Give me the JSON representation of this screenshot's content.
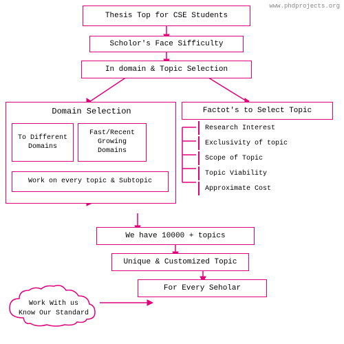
{
  "watermark": "www.phdprojects.org",
  "boxes": {
    "thesis": "Thesis Top for CSE Students",
    "scholar_difficulty": "Scholor's Face Sifficulty",
    "domain_topic": "In domain & Topic Selection",
    "domain_selection": "Domain Selection",
    "factors": "Factot's to Select Topic",
    "to_different": "To Different\nDomains",
    "fast_recent": "Fast/Recent\nGrowing\nDomains",
    "work_every": "Work on every topic &\nSubtopic",
    "research": "Research Interest",
    "exclusivity": "Exclusivity of topic",
    "scope": "Scope of Topic",
    "viability": "Topic Viability",
    "approx_cost": "Approximate Cost",
    "have_topics": "We have 10000 + topics",
    "unique_topic": "Unique & Customized Topic",
    "for_every": "For Every Seholar",
    "cloud": "Work With us\nKnow Our Standard"
  }
}
